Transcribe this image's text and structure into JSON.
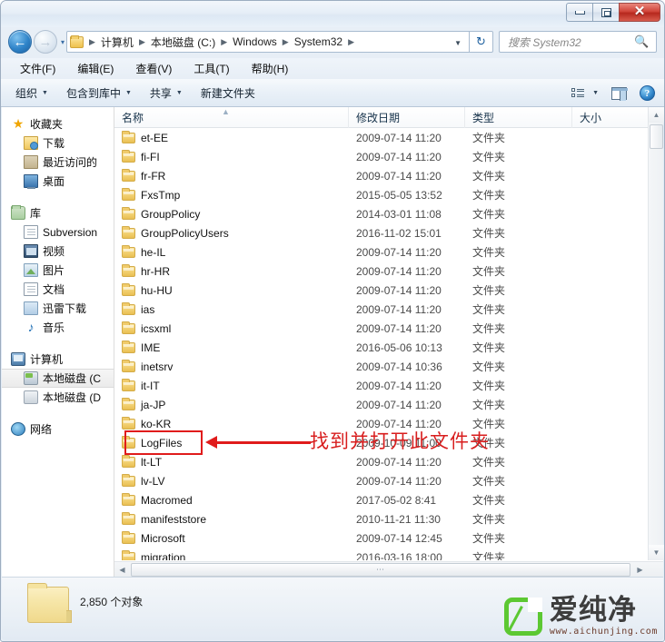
{
  "window": {
    "controls": {
      "minimize": "–",
      "maximize": "□",
      "close": "✕"
    }
  },
  "address": {
    "back_icon": "back-arrow-icon",
    "forward_icon": "forward-arrow-icon",
    "history_caret": "▾",
    "crumbs": [
      "计算机",
      "本地磁盘 (C:)",
      "Windows",
      "System32"
    ],
    "separator": "▶",
    "dropdown_caret": "▼",
    "refresh_icon": "↻"
  },
  "search": {
    "placeholder": "搜索 System32",
    "icon": "magnifier-icon"
  },
  "menu": {
    "items": [
      "文件(F)",
      "编辑(E)",
      "查看(V)",
      "工具(T)",
      "帮助(H)"
    ]
  },
  "toolbar": {
    "buttons": [
      {
        "label": "组织",
        "caret": "▼"
      },
      {
        "label": "包含到库中",
        "caret": "▼"
      },
      {
        "label": "共享",
        "caret": "▼"
      },
      {
        "label": "新建文件夹",
        "caret": ""
      }
    ],
    "view_caret": "▼",
    "help_glyph": "?"
  },
  "sidebar": {
    "groups": [
      {
        "header": {
          "label": "收藏夹",
          "icon": "star-icon"
        },
        "items": [
          {
            "label": "下载",
            "icon": "downloads-icon"
          },
          {
            "label": "最近访问的",
            "icon": "recent-places-icon"
          },
          {
            "label": "桌面",
            "icon": "desktop-icon"
          }
        ]
      },
      {
        "header": {
          "label": "库",
          "icon": "library-icon"
        },
        "items": [
          {
            "label": "Subversion",
            "icon": "document-icon"
          },
          {
            "label": "视频",
            "icon": "video-icon"
          },
          {
            "label": "图片",
            "icon": "pictures-icon"
          },
          {
            "label": "文档",
            "icon": "documents-icon"
          },
          {
            "label": "迅雷下载",
            "icon": "thunder-download-icon"
          },
          {
            "label": "音乐",
            "icon": "music-note-icon"
          }
        ]
      },
      {
        "header": {
          "label": "计算机",
          "icon": "computer-icon"
        },
        "items": [
          {
            "label": "本地磁盘 (C",
            "icon": "hard-disk-c-icon",
            "selected": true
          },
          {
            "label": "本地磁盘 (D",
            "icon": "hard-disk-d-icon",
            "selected": false
          }
        ]
      },
      {
        "header": {
          "label": "网络",
          "icon": "network-icon"
        },
        "items": []
      }
    ]
  },
  "filelist": {
    "columns": [
      "名称",
      "修改日期",
      "类型",
      "大小"
    ],
    "sort_indicator": "▲",
    "rows": [
      {
        "name": "et-EE",
        "date": "2009-07-14 11:20",
        "type": "文件夹",
        "size": ""
      },
      {
        "name": "fi-FI",
        "date": "2009-07-14 11:20",
        "type": "文件夹",
        "size": ""
      },
      {
        "name": "fr-FR",
        "date": "2009-07-14 11:20",
        "type": "文件夹",
        "size": ""
      },
      {
        "name": "FxsTmp",
        "date": "2015-05-05 13:52",
        "type": "文件夹",
        "size": ""
      },
      {
        "name": "GroupPolicy",
        "date": "2014-03-01 11:08",
        "type": "文件夹",
        "size": ""
      },
      {
        "name": "GroupPolicyUsers",
        "date": "2016-11-02 15:01",
        "type": "文件夹",
        "size": ""
      },
      {
        "name": "he-IL",
        "date": "2009-07-14 11:20",
        "type": "文件夹",
        "size": ""
      },
      {
        "name": "hr-HR",
        "date": "2009-07-14 11:20",
        "type": "文件夹",
        "size": ""
      },
      {
        "name": "hu-HU",
        "date": "2009-07-14 11:20",
        "type": "文件夹",
        "size": ""
      },
      {
        "name": "ias",
        "date": "2009-07-14 11:20",
        "type": "文件夹",
        "size": ""
      },
      {
        "name": "icsxml",
        "date": "2009-07-14 11:20",
        "type": "文件夹",
        "size": ""
      },
      {
        "name": "IME",
        "date": "2016-05-06 10:13",
        "type": "文件夹",
        "size": ""
      },
      {
        "name": "inetsrv",
        "date": "2009-07-14 10:36",
        "type": "文件夹",
        "size": ""
      },
      {
        "name": "it-IT",
        "date": "2009-07-14 11:20",
        "type": "文件夹",
        "size": ""
      },
      {
        "name": "ja-JP",
        "date": "2009-07-14 11:20",
        "type": "文件夹",
        "size": ""
      },
      {
        "name": "ko-KR",
        "date": "2009-07-14 11:20",
        "type": "文件夹",
        "size": ""
      },
      {
        "name": "LogFiles",
        "date": "2009-10-09 11:00",
        "type": "文件夹",
        "size": ""
      },
      {
        "name": "lt-LT",
        "date": "2009-07-14 11:20",
        "type": "文件夹",
        "size": ""
      },
      {
        "name": "lv-LV",
        "date": "2009-07-14 11:20",
        "type": "文件夹",
        "size": ""
      },
      {
        "name": "Macromed",
        "date": "2017-05-02 8:41",
        "type": "文件夹",
        "size": ""
      },
      {
        "name": "manifeststore",
        "date": "2010-11-21 11:30",
        "type": "文件夹",
        "size": ""
      },
      {
        "name": "Microsoft",
        "date": "2009-07-14 12:45",
        "type": "文件夹",
        "size": ""
      },
      {
        "name": "migration",
        "date": "2016-03-16 18:00",
        "type": "文件夹",
        "size": ""
      }
    ]
  },
  "scrollbars": {
    "up_arrow": "▲",
    "down_arrow": "▼",
    "left_arrow": "◀",
    "right_arrow": "▶",
    "h_thumb_grip": "⋯"
  },
  "status": {
    "text": "2,850 个对象",
    "folder_icon": "large-folder-icon"
  },
  "annotation": {
    "text": "找到并打开此文件夹",
    "color": "#d81e1e",
    "target_row": "LogFiles"
  },
  "watermark": {
    "brand": "爱纯净",
    "url": "www.aichunjing.com",
    "color": "#5cc832"
  }
}
